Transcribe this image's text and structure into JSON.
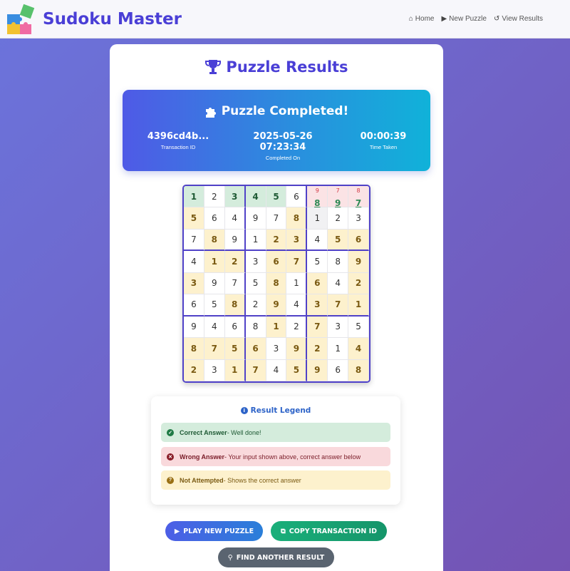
{
  "app": {
    "title": "Sudoku Master"
  },
  "nav": [
    {
      "label": "Home",
      "icon": "home-icon"
    },
    {
      "label": "New Puzzle",
      "icon": "play-icon"
    },
    {
      "label": "View Results",
      "icon": "history-icon"
    }
  ],
  "page": {
    "title": "Puzzle Results"
  },
  "banner": {
    "title": "Puzzle Completed!",
    "transaction_id": "4396cd4b...",
    "transaction_label": "Transaction ID",
    "completed_on": "2025-05-26 07:23:34",
    "completed_label": "Completed On",
    "time_taken": "00:00:39",
    "time_label": "Time Taken"
  },
  "grid": {
    "rows": [
      [
        {
          "v": "1",
          "s": "correct"
        },
        {
          "v": "2",
          "s": "given"
        },
        {
          "v": "3",
          "s": "correct"
        },
        {
          "v": "4",
          "s": "correct"
        },
        {
          "v": "5",
          "s": "correct"
        },
        {
          "v": "6",
          "s": "given"
        },
        {
          "v": "8",
          "s": "wrong",
          "input": "9"
        },
        {
          "v": "9",
          "s": "wrong",
          "input": "7"
        },
        {
          "v": "7",
          "s": "wrong",
          "input": "8"
        }
      ],
      [
        {
          "v": "5",
          "s": "na"
        },
        {
          "v": "6",
          "s": "given"
        },
        {
          "v": "4",
          "s": "given"
        },
        {
          "v": "9",
          "s": "given"
        },
        {
          "v": "7",
          "s": "given"
        },
        {
          "v": "8",
          "s": "na"
        },
        {
          "v": "1",
          "s": "given2"
        },
        {
          "v": "2",
          "s": "given"
        },
        {
          "v": "3",
          "s": "given"
        }
      ],
      [
        {
          "v": "7",
          "s": "given"
        },
        {
          "v": "8",
          "s": "na"
        },
        {
          "v": "9",
          "s": "given"
        },
        {
          "v": "1",
          "s": "given"
        },
        {
          "v": "2",
          "s": "na"
        },
        {
          "v": "3",
          "s": "na"
        },
        {
          "v": "4",
          "s": "given"
        },
        {
          "v": "5",
          "s": "na"
        },
        {
          "v": "6",
          "s": "na"
        }
      ],
      [
        {
          "v": "4",
          "s": "given"
        },
        {
          "v": "1",
          "s": "na"
        },
        {
          "v": "2",
          "s": "na"
        },
        {
          "v": "3",
          "s": "given"
        },
        {
          "v": "6",
          "s": "na"
        },
        {
          "v": "7",
          "s": "na"
        },
        {
          "v": "5",
          "s": "given"
        },
        {
          "v": "8",
          "s": "given"
        },
        {
          "v": "9",
          "s": "na"
        }
      ],
      [
        {
          "v": "3",
          "s": "na"
        },
        {
          "v": "9",
          "s": "given"
        },
        {
          "v": "7",
          "s": "given"
        },
        {
          "v": "5",
          "s": "given"
        },
        {
          "v": "8",
          "s": "na"
        },
        {
          "v": "1",
          "s": "given"
        },
        {
          "v": "6",
          "s": "na"
        },
        {
          "v": "4",
          "s": "given"
        },
        {
          "v": "2",
          "s": "na"
        }
      ],
      [
        {
          "v": "6",
          "s": "given"
        },
        {
          "v": "5",
          "s": "given"
        },
        {
          "v": "8",
          "s": "na"
        },
        {
          "v": "2",
          "s": "given"
        },
        {
          "v": "9",
          "s": "na"
        },
        {
          "v": "4",
          "s": "given"
        },
        {
          "v": "3",
          "s": "na"
        },
        {
          "v": "7",
          "s": "na"
        },
        {
          "v": "1",
          "s": "na"
        }
      ],
      [
        {
          "v": "9",
          "s": "given"
        },
        {
          "v": "4",
          "s": "given"
        },
        {
          "v": "6",
          "s": "given"
        },
        {
          "v": "8",
          "s": "given"
        },
        {
          "v": "1",
          "s": "na"
        },
        {
          "v": "2",
          "s": "given"
        },
        {
          "v": "7",
          "s": "na"
        },
        {
          "v": "3",
          "s": "given"
        },
        {
          "v": "5",
          "s": "given"
        }
      ],
      [
        {
          "v": "8",
          "s": "na"
        },
        {
          "v": "7",
          "s": "na"
        },
        {
          "v": "5",
          "s": "na"
        },
        {
          "v": "6",
          "s": "na"
        },
        {
          "v": "3",
          "s": "given"
        },
        {
          "v": "9",
          "s": "na"
        },
        {
          "v": "2",
          "s": "na"
        },
        {
          "v": "1",
          "s": "given"
        },
        {
          "v": "4",
          "s": "na"
        }
      ],
      [
        {
          "v": "2",
          "s": "na"
        },
        {
          "v": "3",
          "s": "given"
        },
        {
          "v": "1",
          "s": "na"
        },
        {
          "v": "7",
          "s": "na"
        },
        {
          "v": "4",
          "s": "given"
        },
        {
          "v": "5",
          "s": "na"
        },
        {
          "v": "9",
          "s": "na"
        },
        {
          "v": "6",
          "s": "given"
        },
        {
          "v": "8",
          "s": "na"
        }
      ]
    ]
  },
  "legend": {
    "title": "Result Legend",
    "correct_label": "Correct Answer",
    "correct_desc": "- Well done!",
    "wrong_label": "Wrong Answer",
    "wrong_desc": "- Your input shown above, correct answer below",
    "na_label": "Not Attempted",
    "na_desc": "- Shows the correct answer"
  },
  "buttons": {
    "play": "PLAY NEW PUZZLE",
    "copy": "COPY TRANSACTION ID",
    "find": "FIND ANOTHER RESULT"
  },
  "colors": {
    "brand": "#4a3fd6",
    "correct_bg": "#d4ecdc",
    "wrong_bg": "#f9d9dc",
    "na_bg": "#fdf1cd"
  }
}
